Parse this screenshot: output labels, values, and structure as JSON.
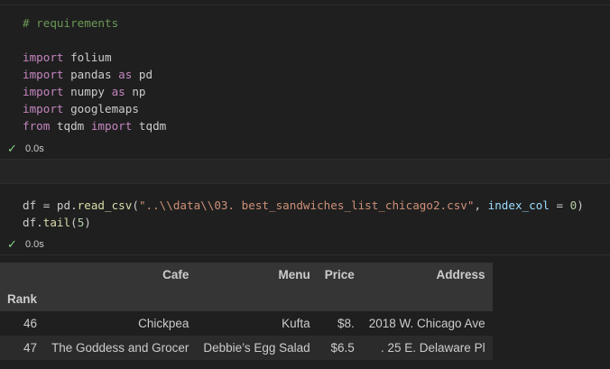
{
  "cell1": {
    "comment": "# requirements",
    "lines": [
      {
        "kw": "import",
        "mod": " folium",
        "kw2": "",
        "alias": ""
      },
      {
        "kw": "import",
        "mod": " pandas ",
        "kw2": "as",
        "alias": " pd"
      },
      {
        "kw": "import",
        "mod": " numpy ",
        "kw2": "as",
        "alias": " np"
      },
      {
        "kw": "import",
        "mod": " googlemaps",
        "kw2": "",
        "alias": ""
      }
    ],
    "from_line": {
      "kw": "from",
      "mod": " tqdm ",
      "kw2": "import",
      "name": " tqdm"
    },
    "status_time": "0.0s"
  },
  "cell2": {
    "line1_var": "df = pd.",
    "line1_fn": "read_csv",
    "line1_open": "(",
    "line1_str": "\"..\\\\data\\\\03. best_sandwiches_list_chicago2.csv\"",
    "line1_comma": ", ",
    "line1_param": "index_col",
    "line1_eq": " = ",
    "line1_num": "0",
    "line1_close": ")",
    "line2_var": "df.",
    "line2_fn": "tail",
    "line2_open": "(",
    "line2_num": "5",
    "line2_close": ")",
    "status_time": "0.0s"
  },
  "table": {
    "columns": [
      "Cafe",
      "Menu",
      "Price",
      "Address"
    ],
    "index_name": "Rank",
    "rows": [
      {
        "rank": "46",
        "cafe": "Chickpea",
        "menu": "Kufta",
        "price": "$8.",
        "address": "2018 W. Chicago Ave"
      },
      {
        "rank": "47",
        "cafe": "The Goddess and Grocer",
        "menu": "Debbie’s Egg Salad",
        "price": "$6.5",
        "address": ". 25 E. Delaware Pl"
      }
    ]
  },
  "icons": {
    "status": "check-icon"
  }
}
